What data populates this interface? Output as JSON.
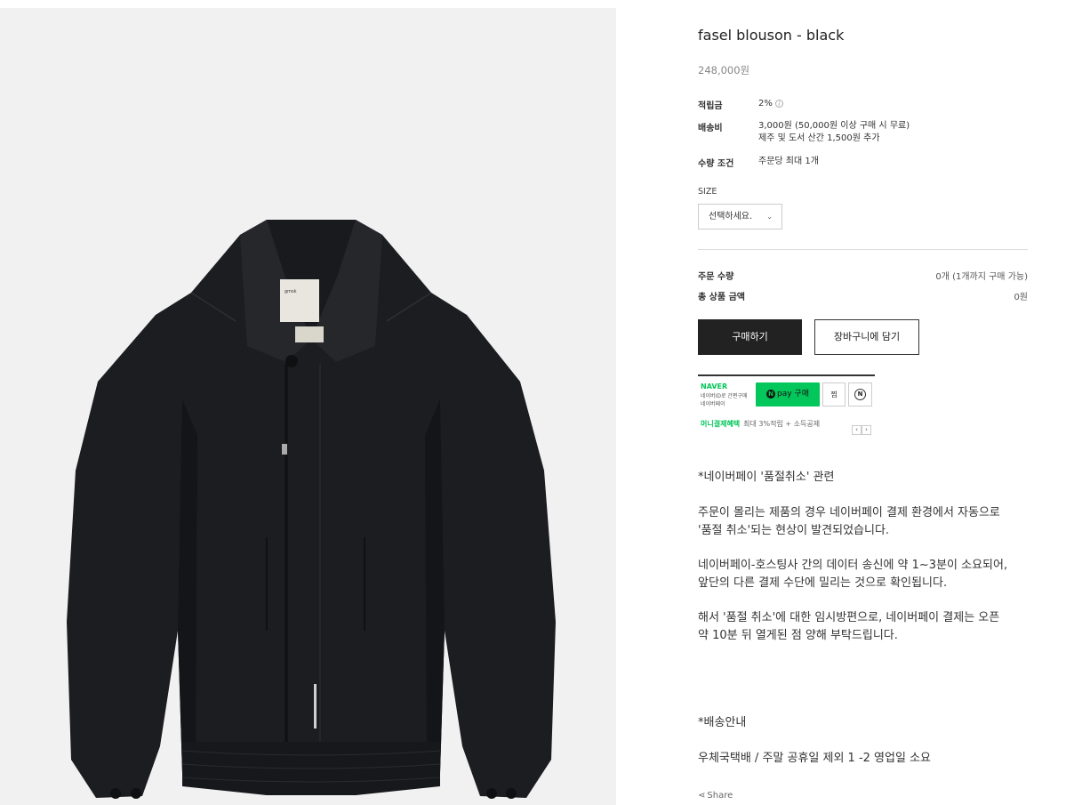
{
  "product": {
    "title": "fasel blouson - black",
    "price": "248,000원"
  },
  "details": {
    "points_label": "적립금",
    "points_value": "2%",
    "info_icon": "i",
    "shipping_label": "배송비",
    "shipping_line1": "3,000원 (50,000원 이상 구매 시 무료)",
    "shipping_line2": "제주 및 도서 산간 1,500원 추가",
    "quantity_label": "수량 조건",
    "quantity_value": "주문당 최대 1개"
  },
  "option": {
    "label": "SIZE",
    "placeholder": "선택하세요.",
    "chevron": "⌄"
  },
  "summary": {
    "qty_label": "주문 수량",
    "qty_value": "0개 (1개까지 구매 가능)",
    "total_label": "총 상품 금액",
    "total_value": "0원"
  },
  "actions": {
    "buy_label": "구매하기",
    "cart_label": "장바구니에 담기"
  },
  "naver_pay": {
    "brand": "NAVER",
    "sub1": "네이버ID로 간편구매",
    "sub2": "네이버페이",
    "pay_logo": "N",
    "pay_label": "pay 구매",
    "zzim_label": "찜",
    "n_label": "N",
    "benefit_label": "머니결제혜택",
    "benefit_text": "최대 3%적립 + 소득공제",
    "prev_arrow": "‹",
    "next_arrow": "›",
    "brand_color": "#03c75a"
  },
  "description": [
    "*네이버페이 '품절취소' 관련",
    "주문이 몰리는 제품의 경우 네이버페이 결제 환경에서 자동으로",
    "'품절 취소'되는 현상이 발견되었습니다.",
    "네이버페이-호스팅사 간의 데이터 송신에 약 1~3분이 소요되어,",
    "앞단의 다른 결제 수단에 밀리는 것으로 확인됩니다.",
    "해서 '품절 취소'에 대한 임시방편으로, 네이버페이 결제는 오픈",
    "약 10분 뒤 열게된 점 양해 부탁드립니다.",
    "*배송안내",
    "우체국택배 / 주말 공휴일 제외 1 -2 영업일 소요"
  ],
  "share": {
    "icon": "share-icon",
    "label": "Share"
  },
  "image": {
    "label_text": "gmsk"
  }
}
